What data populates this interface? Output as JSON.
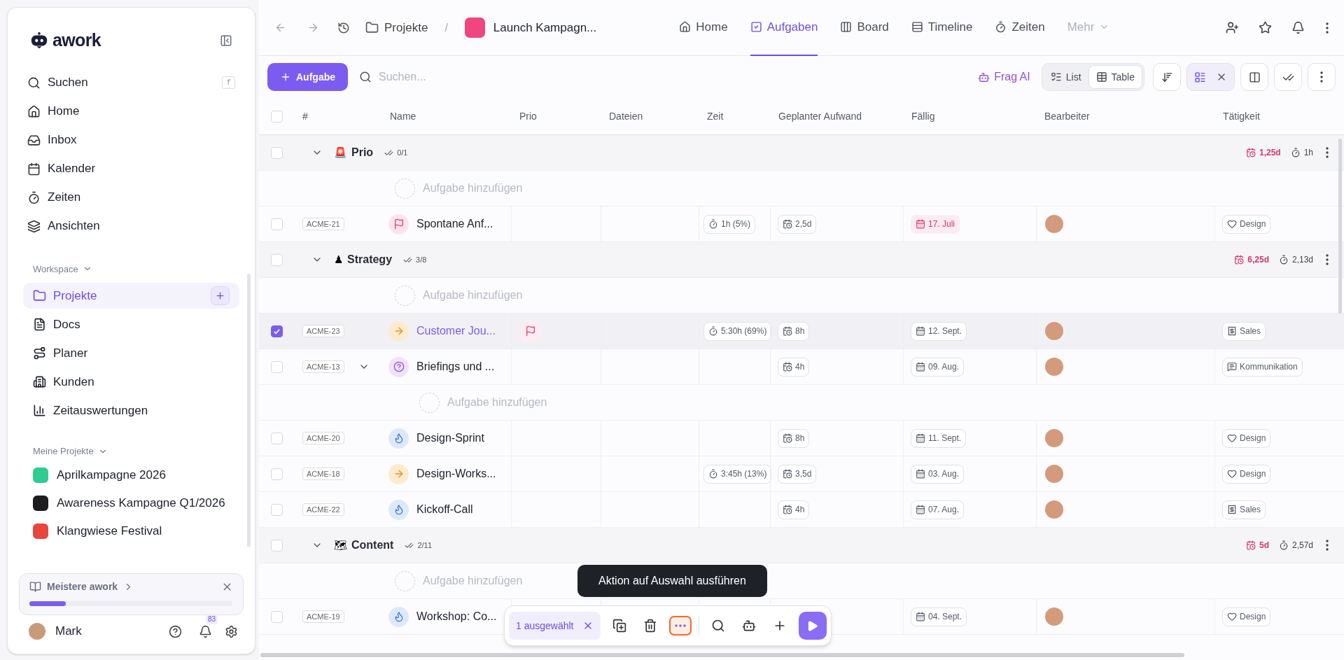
{
  "sidebar": {
    "brand": "awork",
    "nav": [
      {
        "label": "Suchen",
        "shortcut": "f"
      },
      {
        "label": "Home"
      },
      {
        "label": "Inbox"
      },
      {
        "label": "Kalender"
      },
      {
        "label": "Zeiten"
      },
      {
        "label": "Ansichten"
      }
    ],
    "workspace": {
      "title": "Workspace",
      "items": [
        {
          "label": "Projekte",
          "selected": true
        },
        {
          "label": "Docs",
          "selected": false
        },
        {
          "label": "Planer",
          "selected": false
        },
        {
          "label": "Kunden",
          "selected": false
        },
        {
          "label": "Zeitauswertungen",
          "selected": false
        }
      ]
    },
    "my_projects": {
      "title": "Meine Projekte",
      "items": [
        {
          "label": "Aprilkampagne 2026",
          "color": "#2ecc8f"
        },
        {
          "label": "Awareness Kampagne Q1/2026",
          "color": "#1d1d1f"
        },
        {
          "label": "Klangwiese Festival",
          "color": "#e8453c"
        }
      ]
    },
    "onboarding": {
      "label": "Meistere awork",
      "level": 0.18
    },
    "user": {
      "name": "Mark",
      "notifications": "83"
    }
  },
  "topbar": {
    "breadcrumb": [
      "Projekte",
      "/",
      "Launch Kampagn..."
    ],
    "tabs": [
      {
        "label": "Home",
        "selected": false
      },
      {
        "label": "Aufgaben",
        "selected": true
      },
      {
        "label": "Board",
        "selected": false
      },
      {
        "label": "Timeline",
        "selected": false
      },
      {
        "label": "Zeiten",
        "selected": false
      },
      {
        "label": "Mehr",
        "selected": false
      }
    ]
  },
  "toolbar": {
    "add_button": "Aufgabe",
    "search": {
      "placeholder": "Suchen..."
    },
    "ai_button": "Frag AI",
    "views": [
      {
        "label": "List",
        "selected": false
      },
      {
        "label": "Table",
        "selected": true
      }
    ]
  },
  "table": {
    "checked": false,
    "columns": [
      "#",
      "Name",
      "Prio",
      "Dateien",
      "Zeit",
      "Geplanter Aufwand",
      "Fällig",
      "Bearbeiter",
      "Tätigkeit"
    ],
    "groups": [
      {
        "name": "Prio",
        "emoji": "🚨",
        "progress": "0/1",
        "planned": "1,25d",
        "tracked": "1h",
        "checked": false,
        "expanded": true,
        "rows": [
          {
            "kind": "add",
            "label": "Aufgabe hinzufügen"
          },
          {
            "kind": "flag",
            "checked": false,
            "id": "ACME-21",
            "name": "Spontane Anf...",
            "prio": false,
            "time": "1h (5%)",
            "planned": "2,5d",
            "due": "17. Juli",
            "overdue": true,
            "activity": {
              "kind": "heart",
              "label": "Design"
            }
          }
        ]
      },
      {
        "name": "Strategy",
        "emoji": "♟",
        "progress": "3/8",
        "planned": "6,25d",
        "tracked": "2,13d",
        "checked": false,
        "expanded": true,
        "rows": [
          {
            "kind": "add",
            "label": "Aufgabe hinzufügen"
          },
          {
            "kind": "arrow",
            "checked": true,
            "id": "ACME-23",
            "name": "Customer Jou...",
            "prio": true,
            "time": "5:30h (69%)",
            "planned": "8h",
            "due": "12. Sept.",
            "overdue": false,
            "activity": {
              "kind": "sales",
              "label": "Sales"
            }
          },
          {
            "kind": "question",
            "checked": false,
            "id": "ACME-13",
            "name": "Briefings und ...",
            "prio": false,
            "planned": "4h",
            "due": "09. Aug.",
            "overdue": false,
            "activity": {
              "kind": "message",
              "label": "Kommunikation"
            },
            "expanded": true,
            "children": [
              {
                "kind": "add",
                "label": "Aufgabe hinzufügen"
              }
            ]
          },
          {
            "kind": "fire",
            "checked": false,
            "id": "ACME-20",
            "name": "Design-Sprint",
            "prio": false,
            "planned": "8h",
            "due": "11. Sept.",
            "overdue": false,
            "activity": {
              "kind": "heart",
              "label": "Design"
            }
          },
          {
            "kind": "arrow",
            "checked": false,
            "id": "ACME-18",
            "name": "Design-Works...",
            "prio": false,
            "time": "3:45h (13%)",
            "planned": "3,5d",
            "due": "03. Aug.",
            "overdue": false,
            "activity": {
              "kind": "heart",
              "label": "Design"
            }
          },
          {
            "kind": "fire",
            "checked": false,
            "id": "ACME-22",
            "name": "Kickoff-Call",
            "prio": false,
            "planned": "4h",
            "due": "07. Aug.",
            "overdue": false,
            "activity": {
              "kind": "sales",
              "label": "Sales"
            }
          }
        ]
      },
      {
        "name": "Content",
        "emoji": "🗺",
        "progress": "2/11",
        "planned": "5d",
        "tracked": "2,57d",
        "checked": false,
        "expanded": true,
        "rows": [
          {
            "kind": "add",
            "label": "Aufgabe hinzufügen"
          },
          {
            "kind": "fire",
            "checked": false,
            "id": "ACME-19",
            "name": "Workshop: Co...",
            "prio": false,
            "due": "04. Sept.",
            "overdue": false,
            "activity": {
              "kind": "heart",
              "label": "Design"
            }
          }
        ]
      }
    ]
  },
  "selection_bar": {
    "count": "1 ausgewählt",
    "tooltip": "Aktion auf Auswahl ausführen"
  }
}
